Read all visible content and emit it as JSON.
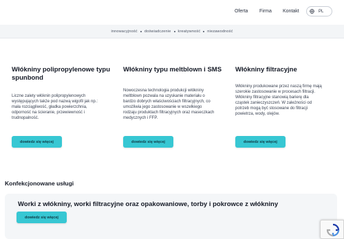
{
  "nav": {
    "oferta": "Oferta",
    "firma": "Firma",
    "kontakt": "Kontakt",
    "lang": "PL"
  },
  "tagline": [
    "innowacyjność",
    "doświadczenie",
    "kreatywność",
    "niezawodność"
  ],
  "columns": [
    {
      "title": "Włókniny polipropylenowe typu spunbond",
      "text": "Liczne zalety włóknin polipropylenowych występujących także pod nazwą wigofil jak np.: mała rozciągliwość, gładka powierzchnia, odporność na ścieranie, przewiewność i trudnopalność.",
      "button": "dowiedz się więcej"
    },
    {
      "title": "Włókniny typu meltblown i SMS",
      "text": "Nowoczesna technologia produkcji włókniny meltblown pozwala na uzyskanie materiału o bardzo dobrych właściwościach filtracyjnych, co umożliwia jego zastosowanie w wszelkiego rodzaju produktach filtracyjnych oraz maseczkach medycznych i FFP.",
      "button": "dowiedz się więcej"
    },
    {
      "title": "Włókniny filtracyjne",
      "text": "Włókniny produkowane przez naszą firmę mają szerokie zastosowanie w procesach filtracji. Włókniny filtracyjne stanowią barierę dla cząstek zanieczyszczeń. W zależności od potrzeb mogą być stosowane do filtracji powietrza, wody, olejów.",
      "button": "dowiedz się więcej"
    }
  ],
  "section": {
    "title": "Konfekcjonowane usługi"
  },
  "card": {
    "title": "Worki z włókniny, worki filtracyjne oraz opakowaniowe, torby i pokrowce z włókniny",
    "button": "dowiedz się więcej"
  },
  "colors": {
    "accent": "#37c7d3",
    "tagbar_bg": "#f3f5f7",
    "card_bg": "#f4f6f8"
  },
  "icons": {
    "language": "globe-icon",
    "recaptcha": "recaptcha-icon"
  }
}
